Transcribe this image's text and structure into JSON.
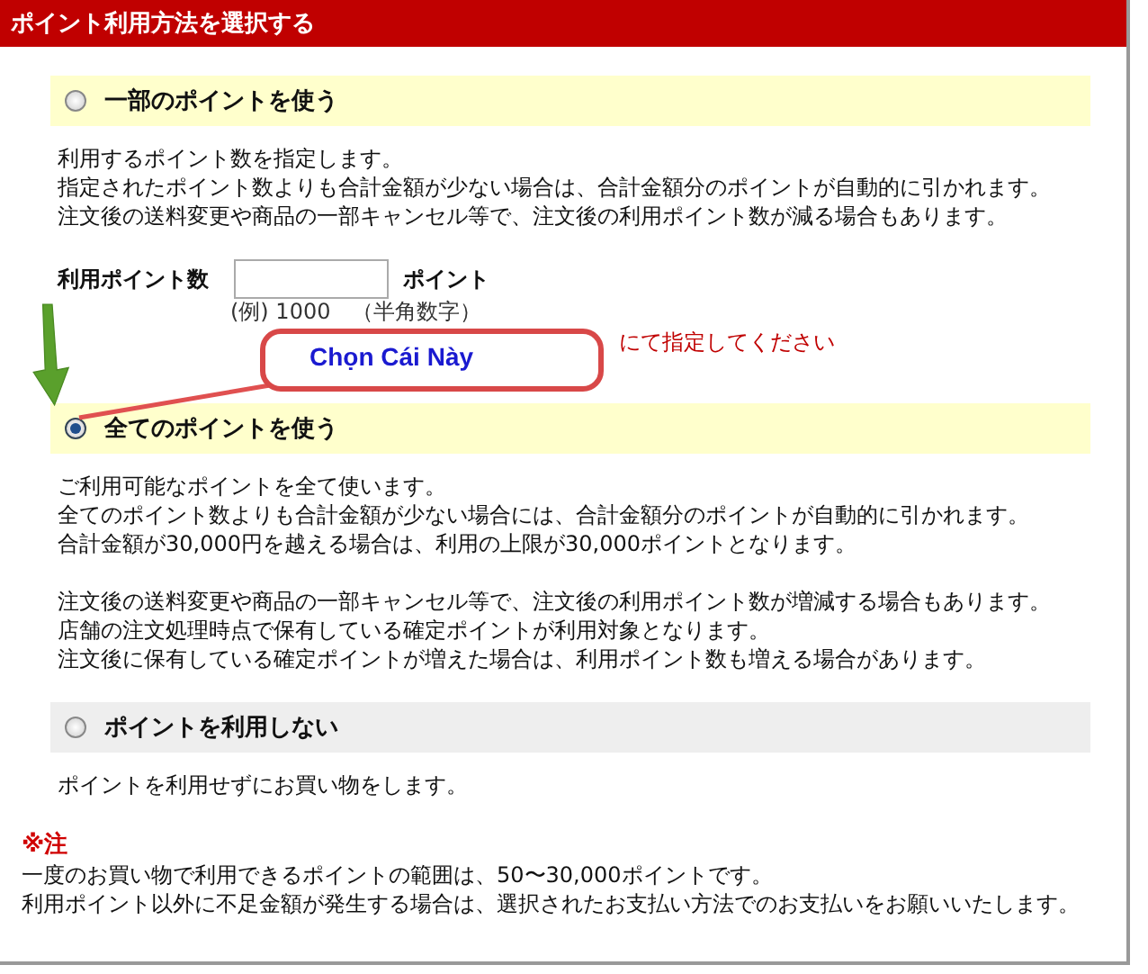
{
  "header": {
    "title": "ポイント利用方法を選択する"
  },
  "options": [
    {
      "label": "一部のポイントを使う",
      "selected": false,
      "color": "#ffffcc",
      "paragraphs": [
        [
          "利用するポイント数を指定します。",
          "指定されたポイント数よりも合計金額が少ない場合は、合計金額分のポイントが自動的に引かれます。",
          "注文後の送料変更や商品の一部キャンセル等で、注文後の利用ポイント数が減る場合もあります。"
        ]
      ],
      "field": {
        "label": "利用ポイント数",
        "unit": "ポイント",
        "example": "(例) 1000　（半角数字）",
        "warning": "にて指定してください"
      }
    },
    {
      "label": "全てのポイントを使う",
      "selected": true,
      "color": "#ffffcc",
      "paragraphs": [
        [
          "ご利用可能なポイントを全て使います。",
          "全てのポイント数よりも合計金額が少ない場合には、合計金額分のポイントが自動的に引かれます。",
          "合計金額が30,000円を越える場合は、利用の上限が30,000ポイントとなります。"
        ],
        [
          "注文後の送料変更や商品の一部キャンセル等で、注文後の利用ポイント数が増減する場合もあります。",
          "店舗の注文処理時点で保有している確定ポイントが利用対象となります。",
          "注文後に保有している確定ポイントが増えた場合は、利用ポイント数も増える場合があります。"
        ]
      ]
    },
    {
      "label": "ポイントを利用しない",
      "selected": false,
      "color": "#eeeeee",
      "paragraphs": [
        [
          "ポイントを利用せずにお買い物をします。"
        ]
      ]
    }
  ],
  "note": {
    "heading": "※注",
    "lines": [
      "一度のお買い物で利用できるポイントの範囲は、50〜30,000ポイントです。",
      "利用ポイント以外に不足金額が発生する場合は、選択されたお支払い方法でのお支払いをお願いいたします。"
    ]
  },
  "callout": {
    "text": "Chọn Cái Này"
  }
}
